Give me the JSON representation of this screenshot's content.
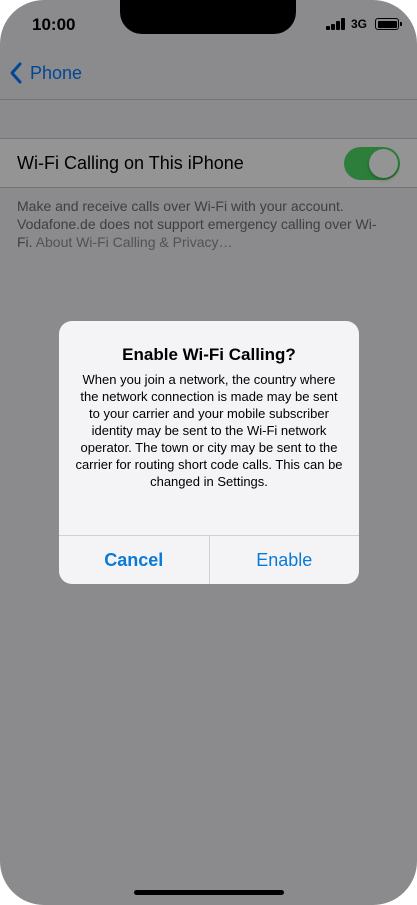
{
  "status_bar": {
    "time": "10:00",
    "network": "3G"
  },
  "nav": {
    "back_label": "Phone",
    "back_icon": "chevron-left-icon"
  },
  "settings": {
    "wifi_calling_label": "Wi-Fi Calling on This iPhone",
    "wifi_calling_enabled": true,
    "footer_text": "Make and receive calls over Wi-Fi with your account. Vodafone.de does not support emergency calling over Wi-Fi. ",
    "footer_link": "About Wi-Fi Calling & Privacy…"
  },
  "alert": {
    "title": "Enable Wi-Fi Calling?",
    "message": "When you join a network, the country where the network connection is made may be sent to your carrier and your mobile subscriber identity may be sent to the Wi-Fi network operator. The town or city may be sent to the carrier for routing short code calls. This can be changed in Settings.",
    "cancel_label": "Cancel",
    "enable_label": "Enable"
  },
  "colors": {
    "accent": "#007aff",
    "toggle_on": "#4cd964",
    "alert_button": "#0a7ad8"
  }
}
